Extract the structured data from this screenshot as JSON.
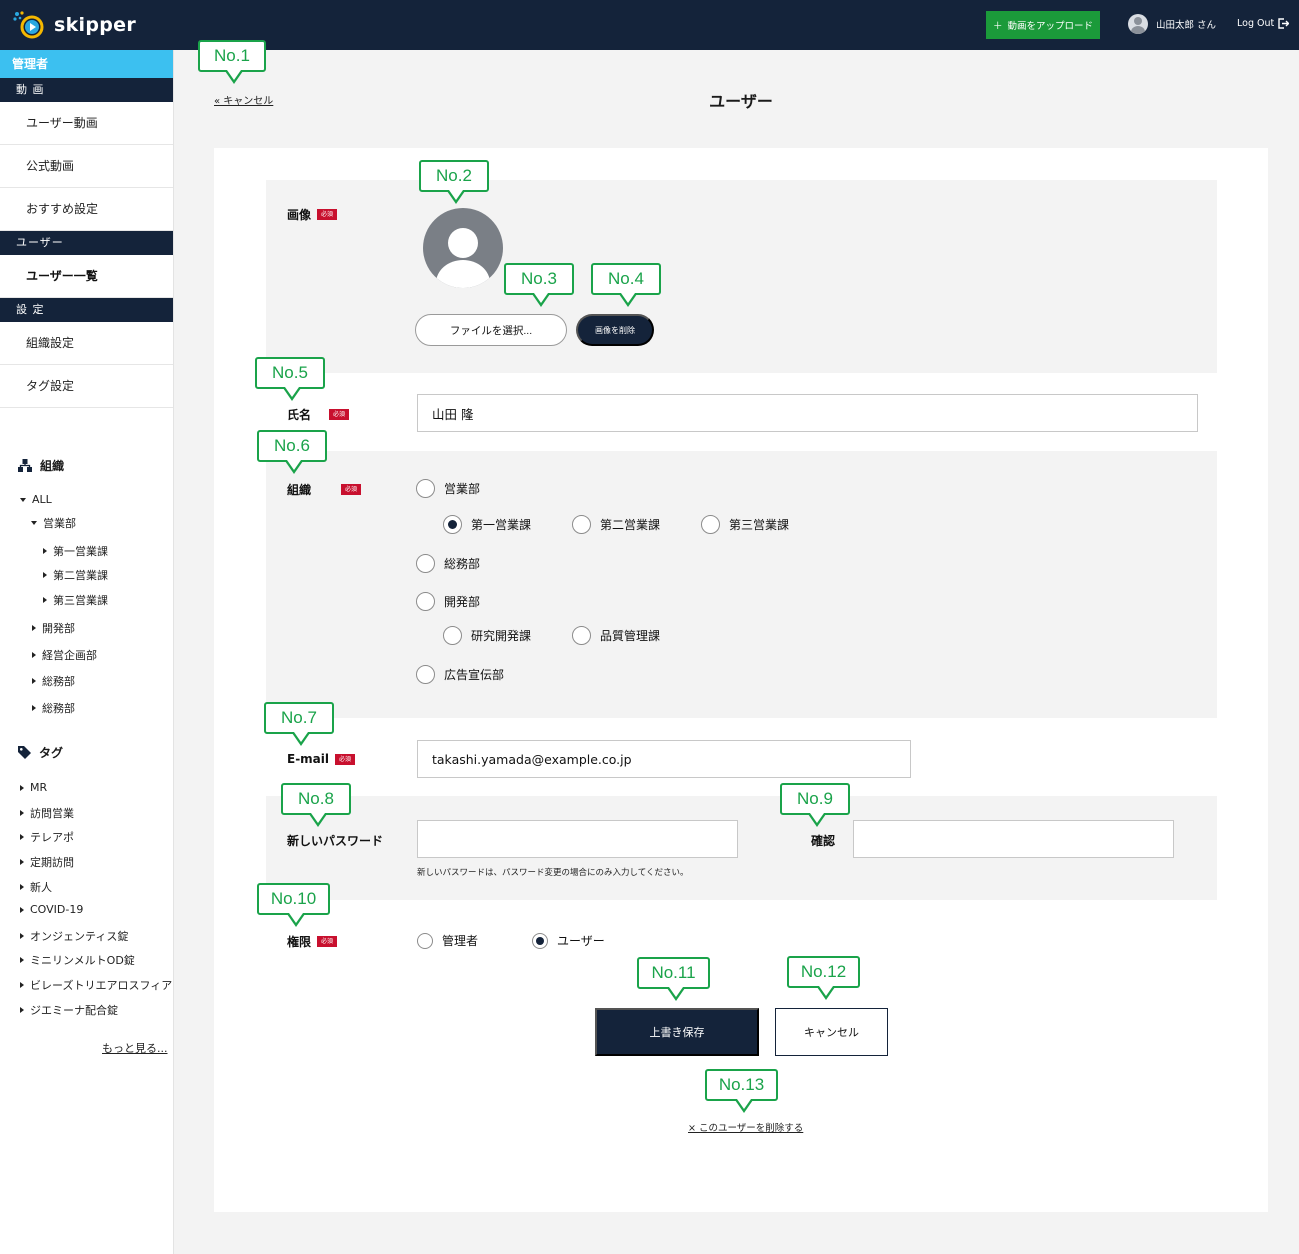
{
  "header": {
    "logo_text": "skipper",
    "upload_label": "動画をアップロード",
    "user_name": "山田太郎 さん",
    "logout_label": "Log Out"
  },
  "sidebar": {
    "role": "管理者",
    "sections": [
      {
        "title": "動 画",
        "items": [
          "ユーザー動画",
          "公式動画",
          "おすすめ設定"
        ]
      },
      {
        "title": "ユーザー",
        "items": [
          "ユーザー一覧"
        ]
      },
      {
        "title": "設 定",
        "items": [
          "組織設定",
          "タグ設定"
        ]
      }
    ],
    "org_heading": "組織",
    "org_tree": [
      "ALL",
      "営業部",
      "第一営業課",
      "第二営業課",
      "第三営業課",
      "開発部",
      "経営企画部",
      "総務部",
      "総務部"
    ],
    "tag_heading": "タグ",
    "tags": [
      "MR",
      "訪問営業",
      "テレアポ",
      "定期訪問",
      "新人",
      "COVID-19",
      "オンジェンティス錠",
      "ミニリンメルトOD錠",
      "ビレーズトリエアロスフィア",
      "ジエミーナ配合錠"
    ],
    "more_label": "もっと見る..."
  },
  "page": {
    "cancel_top": "« キャンセル",
    "title": "ユーザー"
  },
  "form": {
    "required_badge": "必須",
    "image_label": "画像",
    "file_button": "ファイルを選択...",
    "delete_image_button": "画像を削除",
    "name_label": "氏名",
    "name_value": "山田 隆",
    "org_label": "組織",
    "org_options": [
      "営業部",
      "第一営業課",
      "第二営業課",
      "第三営業課",
      "総務部",
      "開発部",
      "研究開発課",
      "品質管理課",
      "広告宣伝部"
    ],
    "org_selected": "第一営業課",
    "email_label": "E-mail",
    "email_value": "takashi.yamada@example.co.jp",
    "password_label": "新しいパスワード",
    "confirm_label": "確認",
    "password_hint": "新しいパスワードは、パスワード変更の場合にのみ入力してください。",
    "role_label": "権限",
    "role_options": [
      "管理者",
      "ユーザー"
    ],
    "role_selected": "ユーザー",
    "save_button": "上書き保存",
    "cancel_button": "キャンセル",
    "delete_link": "× このユーザーを削除する"
  },
  "callouts": [
    "No.1",
    "No.2",
    "No.3",
    "No.4",
    "No.5",
    "No.6",
    "No.7",
    "No.8",
    "No.9",
    "No.10",
    "No.11",
    "No.12",
    "No.13"
  ],
  "colors": {
    "navy": "#14233a",
    "accent_blue": "#3cc0f0",
    "upload_green": "#1b9a3a",
    "callout_green": "#1aa34a",
    "required_red": "#c8102e"
  }
}
